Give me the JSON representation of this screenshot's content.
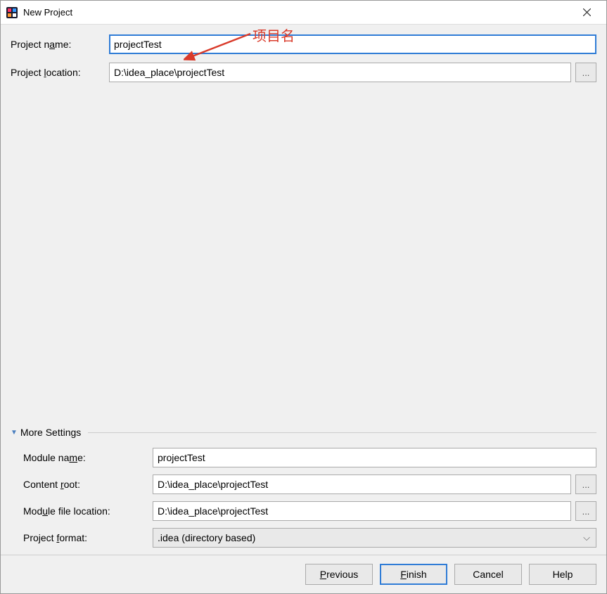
{
  "window": {
    "title": "New Project"
  },
  "annotation": {
    "text": "项目名"
  },
  "form": {
    "project_name_label_pre": "Project n",
    "project_name_label_u": "a",
    "project_name_label_post": "me:",
    "project_name_value": "projectTest",
    "project_location_label_pre": "Project ",
    "project_location_label_u": "l",
    "project_location_label_post": "ocation:",
    "project_location_value": "D:\\idea_place\\projectTest",
    "browse_label": "..."
  },
  "more": {
    "header": "More Settings",
    "module_name_label_pre": "Module na",
    "module_name_label_u": "m",
    "module_name_label_post": "e:",
    "module_name_value": "projectTest",
    "content_root_label_pre": "Content ",
    "content_root_label_u": "r",
    "content_root_label_post": "oot:",
    "content_root_value": "D:\\idea_place\\projectTest",
    "module_file_label_pre": "Mod",
    "module_file_label_u": "u",
    "module_file_label_post": "le file location:",
    "module_file_value": "D:\\idea_place\\projectTest",
    "project_format_label_pre": "Project ",
    "project_format_label_u": "f",
    "project_format_label_post": "ormat:",
    "project_format_value": ".idea (directory based)"
  },
  "buttons": {
    "previous_u": "P",
    "previous_post": "revious",
    "finish_u": "F",
    "finish_post": "inish",
    "cancel": "Cancel",
    "help": "Help"
  }
}
